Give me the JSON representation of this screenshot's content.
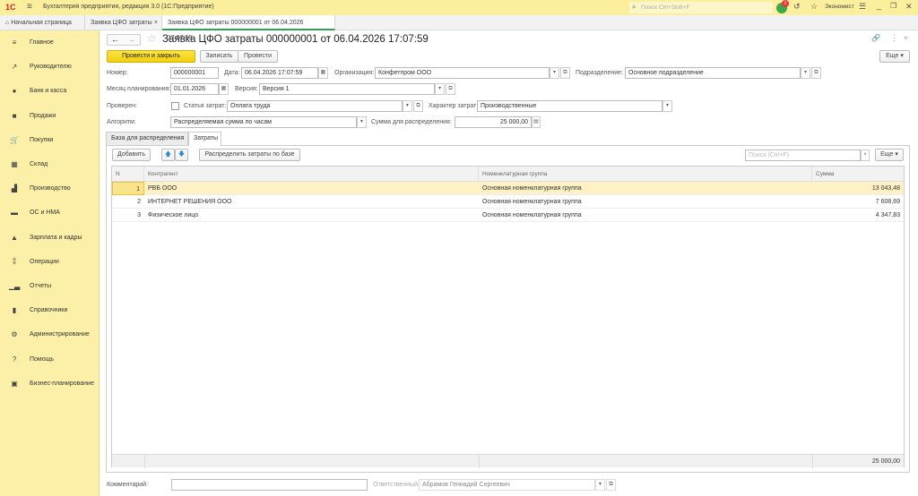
{
  "app": {
    "title": "Бухгалтерия предприятия, редакция 3.0  (1С:Предприятие)",
    "logo": "1С",
    "search_placeholder": "Поиск Ctrl+Shift+F",
    "notification_count": "2",
    "user": "Экономист"
  },
  "tabs": [
    {
      "label": "Начальная страница"
    },
    {
      "label": "Заявка ЦФО затраты"
    },
    {
      "label": "Заявка ЦФО затраты 000000001 от 06.04.2026 17:07:59"
    }
  ],
  "sidebar": {
    "items": [
      {
        "label": "Главное",
        "icon": "menu-icon"
      },
      {
        "label": "Руководителю",
        "icon": "chart-trend-icon"
      },
      {
        "label": "Банк и касса",
        "icon": "coin-icon"
      },
      {
        "label": "Продажи",
        "icon": "bag-icon"
      },
      {
        "label": "Покупки",
        "icon": "cart-icon"
      },
      {
        "label": "Склад",
        "icon": "warehouse-icon"
      },
      {
        "label": "Производство",
        "icon": "factory-icon"
      },
      {
        "label": "ОС и НМА",
        "icon": "truck-icon"
      },
      {
        "label": "Зарплата и кадры",
        "icon": "person-icon"
      },
      {
        "label": "Операции",
        "icon": "operations-icon"
      },
      {
        "label": "Отчеты",
        "icon": "bar-chart-icon"
      },
      {
        "label": "Справочники",
        "icon": "books-icon"
      },
      {
        "label": "Администрирование",
        "icon": "gear-icon"
      },
      {
        "label": "Помощь",
        "icon": "help-icon"
      },
      {
        "label": "Бизнес-планирование",
        "icon": "presentation-icon"
      }
    ]
  },
  "doc": {
    "title": "Заявка ЦФО затраты 000000001 от 06.04.2026 17:07:59",
    "buttons": {
      "post_close": "Провести и закрыть",
      "save": "Записать",
      "post": "Провести",
      "more": "Еще ▾"
    },
    "fields": {
      "number": {
        "label": "Номер:",
        "value": "000000001"
      },
      "date": {
        "label": "Дата:",
        "value": "06.04.2026 17:07:59"
      },
      "organization": {
        "label": "Организация:",
        "value": "Конфетпром ООО"
      },
      "department": {
        "label": "Подразделение:",
        "value": "Основное подразделение"
      },
      "month": {
        "label": "Месяц планирования:",
        "value": "01.01.2026"
      },
      "version": {
        "label": "Версия:",
        "value": "Версия 1"
      },
      "checked": {
        "label": "Проверен:",
        "value": false
      },
      "cost_item": {
        "label": "Статья затрат:",
        "value": "Оплата труда"
      },
      "cost_nature": {
        "label": "Характер затрат:",
        "value": "Производственные"
      },
      "algorithm": {
        "label": "Алгоритм:",
        "value": "Распределяемая сумма по часам"
      },
      "amount": {
        "label": "Сумма для распределения:",
        "value": "25 000,00"
      },
      "comment": {
        "label": "Комментарий:",
        "value": ""
      },
      "responsible": {
        "label": "Ответственный:",
        "value": "Абрамов Геннадий Сергеевич"
      }
    },
    "subtabs": [
      {
        "label": "База для распределения"
      },
      {
        "label": "Затраты"
      }
    ],
    "table_toolbar": {
      "add": "Добавить",
      "distribute": "Распределить затраты по базе",
      "search_placeholder": "Поиск (Ctrl+F)",
      "more": "Еще ▾"
    },
    "table": {
      "columns": [
        "N",
        "Контрагент",
        "Номенклатурная группа",
        "Сумма"
      ],
      "rows": [
        {
          "n": "1",
          "counterparty": "РВБ ООО",
          "group": "Основная номенклатурная группа",
          "sum": "13 043,48"
        },
        {
          "n": "2",
          "counterparty": "ИНТЕРНЕТ РЕШЕНИЯ ООО",
          "group": "Основная номенклатурная группа",
          "sum": "7 608,69"
        },
        {
          "n": "3",
          "counterparty": "Физическое лицо",
          "group": "Основная номенклатурная группа",
          "sum": "4 347,83"
        }
      ],
      "total": "25 000,00"
    }
  }
}
